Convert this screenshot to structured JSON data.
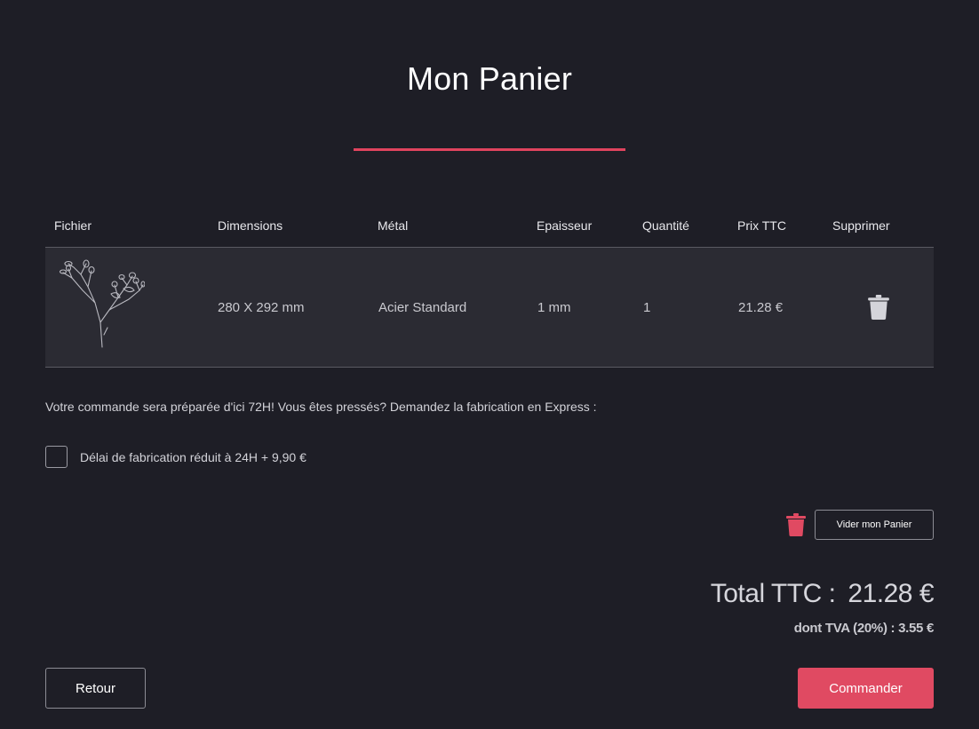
{
  "page": {
    "title": "Mon Panier"
  },
  "table": {
    "headers": {
      "file": "Fichier",
      "dimensions": "Dimensions",
      "metal": "Métal",
      "thickness": "Epaisseur",
      "quantity": "Quantité",
      "price": "Prix TTC",
      "delete": "Supprimer"
    },
    "rows": [
      {
        "thumbnail": "plant-sketch",
        "dimensions": "280 X 292 mm",
        "metal": "Acier Standard",
        "thickness": "1 mm",
        "quantity": "1",
        "price": "21.28 €",
        "delete_icon": "trash-icon"
      }
    ]
  },
  "notice": "Votre commande sera préparée d'ici 72H! Vous êtes pressés? Demandez la fabrication en Express :",
  "express": {
    "label": "Délai de fabrication réduit à 24H + 9,90 €",
    "checked": false
  },
  "cart": {
    "clear_label": "Vider mon Panier",
    "clear_icon": "trash-icon"
  },
  "totals": {
    "total_label": "Total TTC :",
    "total_amount": "21.28 €",
    "tva_text": "dont TVA (20%) : 3.55 €"
  },
  "actions": {
    "back_label": "Retour",
    "order_label": "Commander"
  },
  "colors": {
    "background": "#1e1e26",
    "accent": "#e04a62",
    "row_background": "#2b2b33"
  }
}
